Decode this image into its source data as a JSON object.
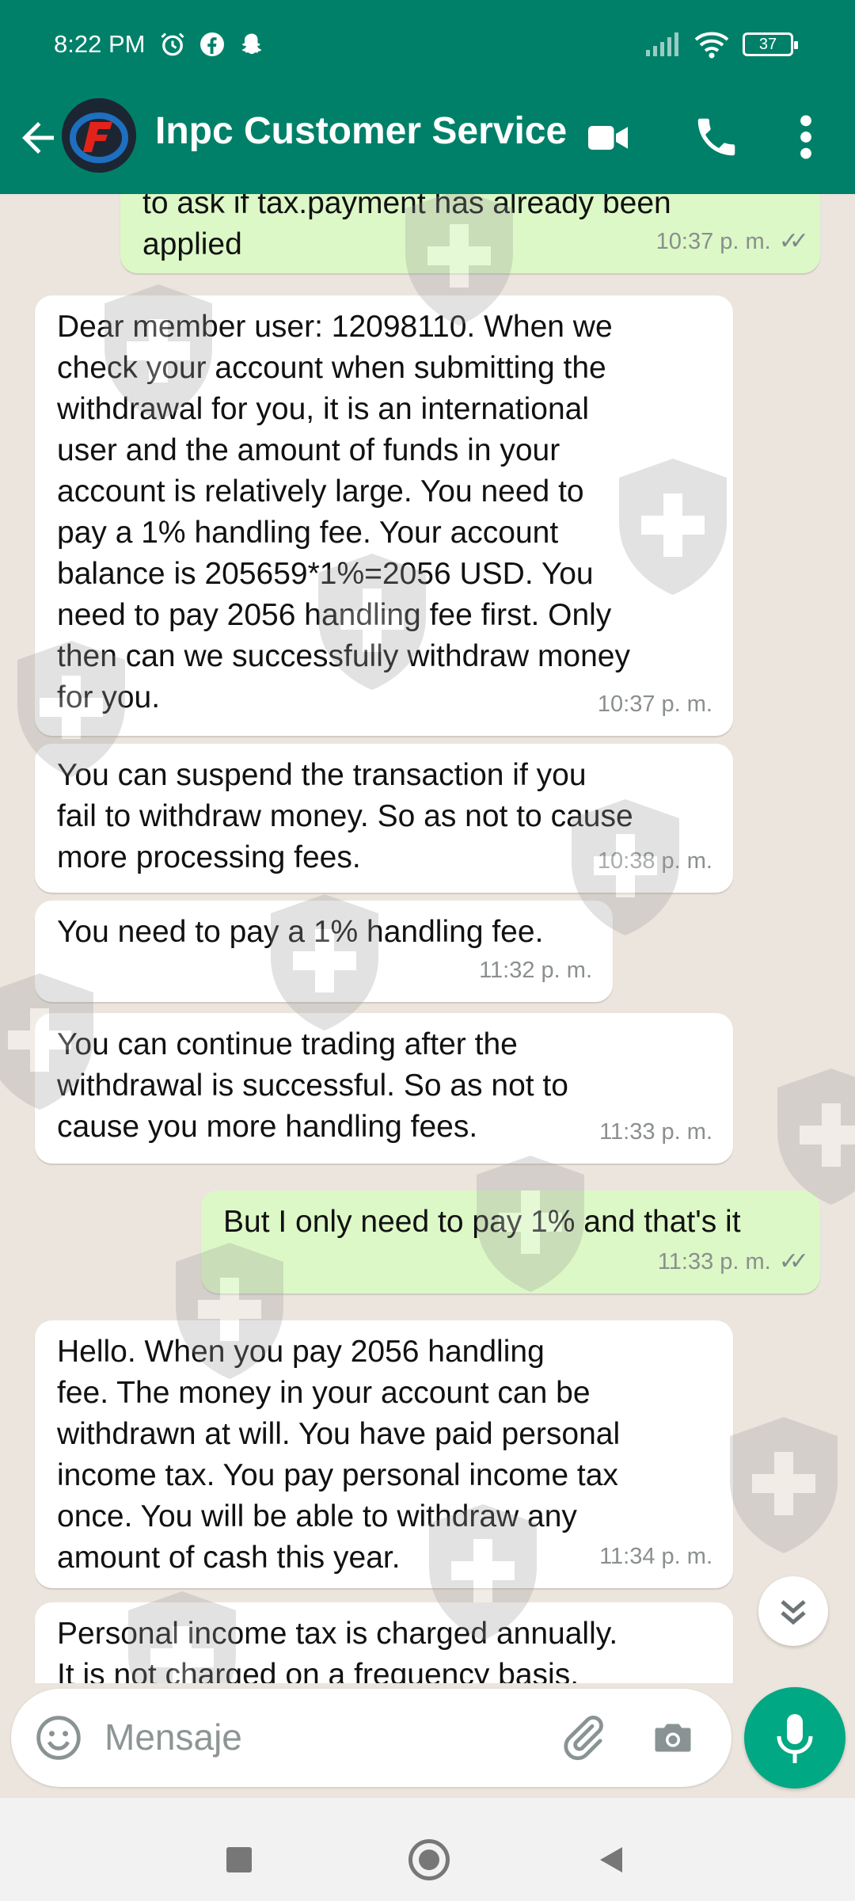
{
  "status_bar": {
    "time": "8:22 PM",
    "battery": "37",
    "left_icons": [
      "alarm-icon",
      "facebook-icon",
      "snapchat-icon"
    ],
    "right_icons": [
      "signal-icon",
      "wifi-icon",
      "battery-icon"
    ]
  },
  "header": {
    "title": "Inpc Customer Service",
    "background": "#008069",
    "icons": [
      "back-arrow-icon",
      "video-call-icon",
      "phone-icon",
      "more-vert-icon"
    ]
  },
  "messages": [
    {
      "direction": "out",
      "lines": [
        "to ask if tax.payment has already been",
        "applied"
      ],
      "time": "10:37 p. m.",
      "read": true
    },
    {
      "direction": "in",
      "lines": [
        "Dear member user: 12098110. When we",
        "check your account when submitting the",
        "withdrawal for you, it is an international",
        "user and the amount of funds in your",
        "account is relatively large. You need to",
        "pay a 1% handling fee. Your account",
        "balance is 205659*1%=2056 USD. You",
        "need to pay 2056 handling fee first. Only",
        "then can we successfully withdraw money",
        "for you."
      ],
      "time": "10:37 p. m."
    },
    {
      "direction": "in",
      "lines": [
        "You can suspend the transaction if you",
        "fail to withdraw money. So as not to cause",
        "more processing fees."
      ],
      "time": "10:38 p. m."
    },
    {
      "direction": "in",
      "lines": [
        "You need to pay a 1% handling fee."
      ],
      "time": "11:32 p. m."
    },
    {
      "direction": "in",
      "lines": [
        "You can continue trading after the",
        "withdrawal is successful. So as not to",
        "cause you more handling fees."
      ],
      "time": "11:33 p. m."
    },
    {
      "direction": "out",
      "lines": [
        "But I only need to pay 1% and that's it"
      ],
      "time": "11:33 p. m.",
      "read": true
    },
    {
      "direction": "in",
      "lines": [
        "Hello. When you pay 2056 handling",
        "fee. The money in your account can be",
        "withdrawn at will. You have paid personal",
        "income tax. You pay personal income tax",
        "once. You will be able to withdraw any",
        "amount of cash this year."
      ],
      "time": "11:34 p. m."
    },
    {
      "direction": "in",
      "lines": [
        "Personal income tax is charged annually.",
        "It is not charged on a frequency basis."
      ],
      "time": ""
    }
  ],
  "composer": {
    "placeholder": "Mensaje",
    "icons": [
      "emoji-icon",
      "attach-icon",
      "camera-icon",
      "mic-icon"
    ],
    "accent": "#00a884"
  },
  "colors": {
    "outgoing_bubble": "#dcf8c6",
    "incoming_bubble": "#ffffff",
    "chat_background": "#ece5dd"
  }
}
